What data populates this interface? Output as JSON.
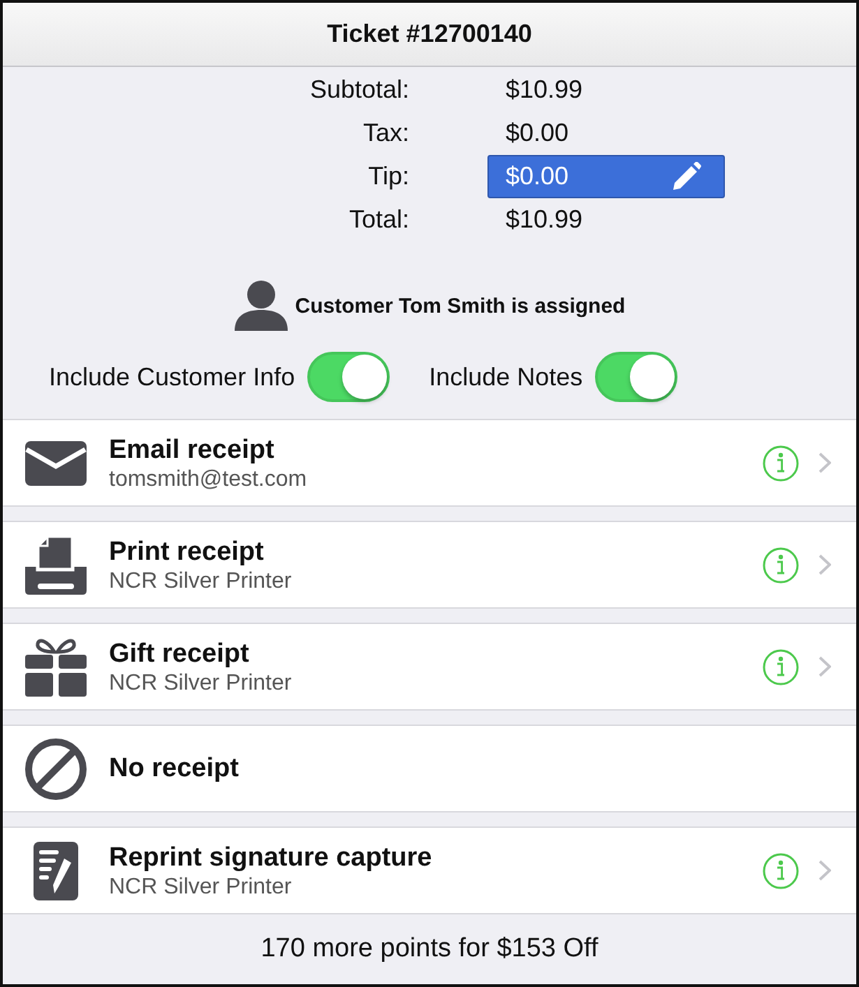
{
  "title": "Ticket #12700140",
  "totals": [
    {
      "label": "Subtotal:",
      "value": "$10.99",
      "kind": "text"
    },
    {
      "label": "Tax:",
      "value": "$0.00",
      "kind": "text"
    },
    {
      "label": "Tip:",
      "value": "$0.00",
      "kind": "field"
    },
    {
      "label": "Total:",
      "value": "$10.99",
      "kind": "text"
    }
  ],
  "customer": {
    "text": "Customer Tom Smith is assigned"
  },
  "toggles": [
    {
      "label": "Include Customer Info",
      "on": true
    },
    {
      "label": "Include Notes",
      "on": true
    }
  ],
  "options": [
    {
      "kind": "email",
      "title": "Email receipt",
      "subtitle": "tomsmith@test.com",
      "info": true
    },
    {
      "kind": "print",
      "title": "Print receipt",
      "subtitle": "NCR Silver Printer",
      "info": true
    },
    {
      "kind": "gift",
      "title": "Gift receipt",
      "subtitle": "NCR Silver Printer",
      "info": true
    },
    {
      "kind": "none",
      "title": "No receipt",
      "info": false
    },
    {
      "kind": "signature",
      "title": "Reprint signature capture",
      "subtitle": "NCR Silver Printer",
      "info": true
    }
  ],
  "footer": "170 more points for $153 Off"
}
